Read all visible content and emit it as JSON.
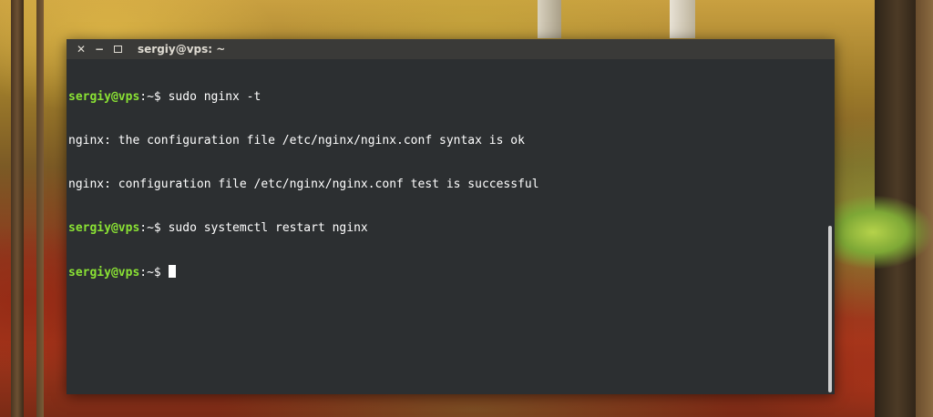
{
  "window": {
    "title": "sergiy@vps: ~",
    "buttons": {
      "close": "✕",
      "minimize": "−"
    }
  },
  "terminal": {
    "lines": [
      {
        "prompt": "sergiy@vps",
        "sep": ":~$",
        "text": " sudo nginx -t"
      },
      {
        "prompt": "",
        "sep": "",
        "text": "nginx: the configuration file /etc/nginx/nginx.conf syntax is ok"
      },
      {
        "prompt": "",
        "sep": "",
        "text": "nginx: configuration file /etc/nginx/nginx.conf test is successful"
      },
      {
        "prompt": "sergiy@vps",
        "sep": ":~$",
        "text": " sudo systemctl restart nginx"
      },
      {
        "prompt": "sergiy@vps",
        "sep": ":~$",
        "text": " "
      }
    ]
  },
  "colors": {
    "prompt": "#8ae234",
    "text": "#ffffff",
    "background": "#2c2f31",
    "titlebar": "#3a3a38"
  }
}
